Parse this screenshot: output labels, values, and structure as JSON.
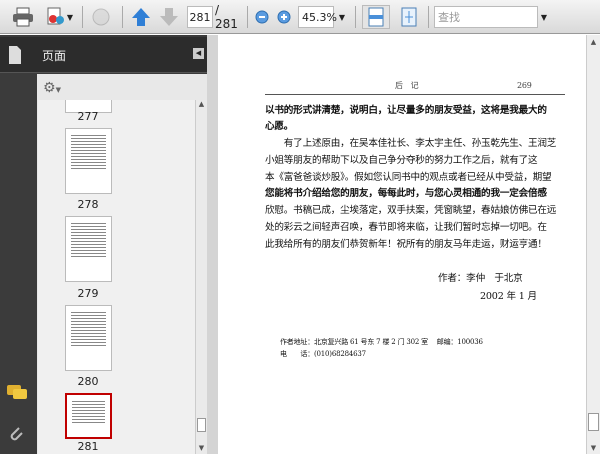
{
  "toolbar": {
    "current_page": "281",
    "total_pages": "/ 281",
    "zoom": "45.3%",
    "search_placeholder": "查找"
  },
  "panel": {
    "title": "页面"
  },
  "thumbnails": [
    {
      "label": "277"
    },
    {
      "label": "278"
    },
    {
      "label": "279"
    },
    {
      "label": "280"
    },
    {
      "label": "281",
      "selected": true
    }
  ],
  "document": {
    "header_title": "后　记",
    "header_page": "269",
    "lines": [
      "以书的形式讲清楚，说明白，让尽量多的朋友受益，这将是我最大的",
      "心愿。",
      "　　有了上述原由，在吴本佳社长、李太宇主任、孙玉乾先生、王润芝",
      "小姐等朋友的帮助下以及自己争分夺秒的努力工作之后，就有了这",
      "本《富爸爸谈炒股》。假如您认同书中的观点或者已经从中受益，期望",
      "您能将书介绍给您的朋友，每每此时，与您心灵相通的我一定会倍感",
      "欣慰。书稿已成，尘埃落定，双手扶案，凭窗眺望，春姑娘仿佛已在远",
      "处的彩云之间轻声召唤，春节即将来临，让我们暂时忘掉一切吧。在",
      "此我给所有的朋友们恭贺新年！祝所有的朋友马年走运，财运亨通！"
    ],
    "signature": "作者：李仲　于北京",
    "date": "2002 年 1 月",
    "address": "作者地址：北京复兴路 61 号东 7 楼 2 门 302 室　 邮编：100036",
    "phone": "电　　话：(010)68284637"
  },
  "colors": {
    "selected_border": "#c00000",
    "accent_blue": "#2f7fd6"
  }
}
